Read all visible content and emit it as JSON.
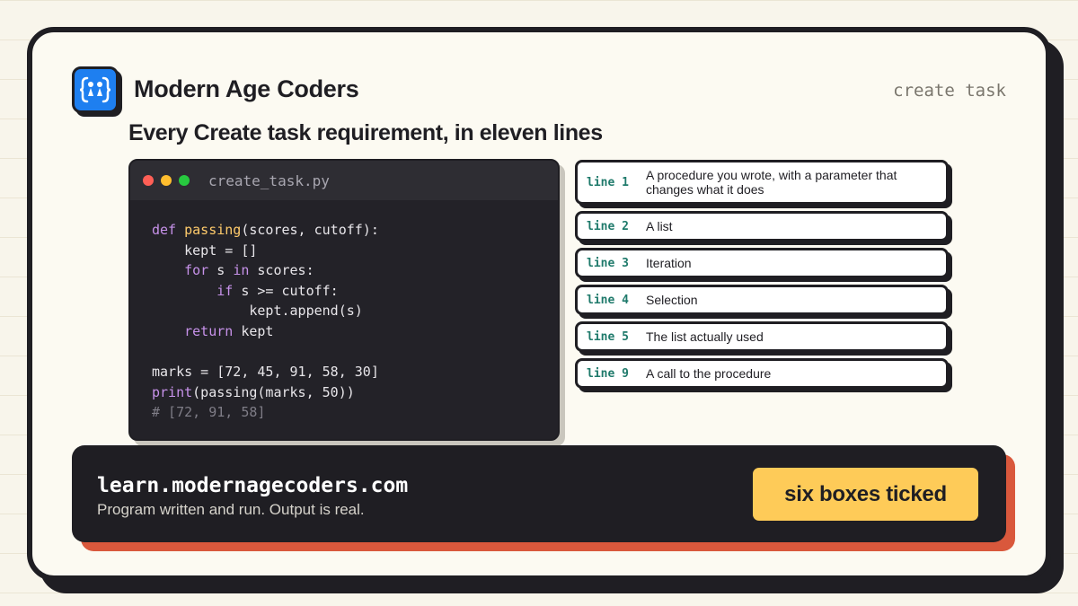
{
  "brand": {
    "name": "Modern Age Coders",
    "logo_icon": "curly-braces-people-icon",
    "logo_color": "#1e7ff0"
  },
  "tag": "create task",
  "headline": "Every Create task requirement, in eleven lines",
  "editor": {
    "file_name": "create_task.py",
    "window_dots": [
      "#ff5f56",
      "#ffbd2e",
      "#27c93f"
    ],
    "code_lines": [
      [
        {
          "t": "def ",
          "c": "kw"
        },
        {
          "t": "passing",
          "c": "fn"
        },
        {
          "t": "(scores, cutoff):",
          "c": ""
        }
      ],
      [
        {
          "t": "    kept = []",
          "c": ""
        }
      ],
      [
        {
          "t": "    ",
          "c": ""
        },
        {
          "t": "for",
          "c": "kw"
        },
        {
          "t": " s ",
          "c": ""
        },
        {
          "t": "in",
          "c": "kw"
        },
        {
          "t": " scores:",
          "c": ""
        }
      ],
      [
        {
          "t": "        ",
          "c": ""
        },
        {
          "t": "if",
          "c": "kw"
        },
        {
          "t": " s >= cutoff:",
          "c": ""
        }
      ],
      [
        {
          "t": "            kept.append(s)",
          "c": ""
        }
      ],
      [
        {
          "t": "    ",
          "c": ""
        },
        {
          "t": "return",
          "c": "kw"
        },
        {
          "t": " kept",
          "c": ""
        }
      ],
      [
        {
          "t": "",
          "c": ""
        }
      ],
      [
        {
          "t": "marks = [72, 45, 91, 58, 30]",
          "c": ""
        }
      ],
      [
        {
          "t": "print",
          "c": "kw"
        },
        {
          "t": "(passing(marks, 50))",
          "c": ""
        }
      ],
      [
        {
          "t": "# [72, 91, 58]",
          "c": "cm"
        }
      ]
    ]
  },
  "requirements": [
    {
      "line": "line 1",
      "text": "A procedure you wrote, with a parameter that changes what it does"
    },
    {
      "line": "line 2",
      "text": "A list"
    },
    {
      "line": "line 3",
      "text": "Iteration"
    },
    {
      "line": "line 4",
      "text": "Selection"
    },
    {
      "line": "line 5",
      "text": "The list actually used"
    },
    {
      "line": "line 9",
      "text": "A call to the procedure"
    }
  ],
  "footer": {
    "url": "learn.modernagecoders.com",
    "tagline": "Program written and run. Output is real.",
    "badge": "six boxes ticked"
  }
}
